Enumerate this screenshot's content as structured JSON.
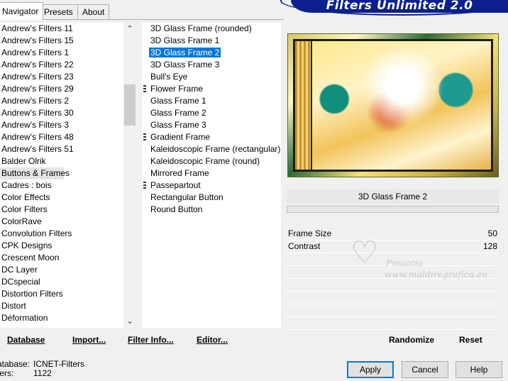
{
  "tabs": [
    {
      "label": "Navigator",
      "active": true
    },
    {
      "label": "Presets",
      "active": false
    },
    {
      "label": "About",
      "active": false
    }
  ],
  "banner_title": "Filters Unlimited 2.0",
  "categories": [
    "Andrew's Filters 11",
    "Andrew's Filters 15",
    "Andrew's Filters 1",
    "Andrew's Filters 22",
    "Andrew's Filters 23",
    "Andrew's Filters 29",
    "Andrew's Filters 2",
    "Andrew's Filters 30",
    "Andrew's Filters 3",
    "Andrew's Filters 48",
    "Andrew's Filters 51",
    "Balder Olrik",
    "Buttons & Frames",
    "Cadres : bois",
    "Color Effects",
    "Color Filters",
    "ColorRave",
    "Convolution Filters",
    "CPK Designs",
    "Crescent Moon",
    "DC Layer",
    "DCspecial",
    "Distortion Filters",
    "Distort",
    "Déformation"
  ],
  "selected_category": "Buttons & Frames",
  "filters": [
    {
      "label": "3D Glass Frame (rounded)",
      "sep": false,
      "selected": false
    },
    {
      "label": "3D Glass Frame 1",
      "sep": false,
      "selected": false
    },
    {
      "label": "3D Glass Frame 2",
      "sep": false,
      "selected": true
    },
    {
      "label": "3D Glass Frame 3",
      "sep": false,
      "selected": false
    },
    {
      "label": "Bull's Eye",
      "sep": false,
      "selected": false
    },
    {
      "label": "Flower Frame",
      "sep": true,
      "selected": false
    },
    {
      "label": "Glass Frame 1",
      "sep": false,
      "selected": false
    },
    {
      "label": "Glass Frame 2",
      "sep": false,
      "selected": false
    },
    {
      "label": "Glass Frame 3",
      "sep": false,
      "selected": false
    },
    {
      "label": "Gradient Frame",
      "sep": true,
      "selected": false
    },
    {
      "label": "Kaleidoscopic Frame (rectangular)",
      "sep": false,
      "selected": false
    },
    {
      "label": "Kaleidoscopic Frame (round)",
      "sep": false,
      "selected": false
    },
    {
      "label": "Mirrored Frame",
      "sep": false,
      "selected": false
    },
    {
      "label": "Passepartout",
      "sep": true,
      "selected": false
    },
    {
      "label": "Rectangular Button",
      "sep": false,
      "selected": false
    },
    {
      "label": "Round Button",
      "sep": false,
      "selected": false
    }
  ],
  "filter_name": "3D Glass Frame 2",
  "params": [
    {
      "label": "Frame Size",
      "value": "50"
    },
    {
      "label": "Contrast",
      "value": "128"
    }
  ],
  "watermark": {
    "name": "Pinuccia",
    "url": "www.maldiregrafica.eu"
  },
  "bottom": {
    "database": "Database",
    "import": "Import...",
    "filter_info": "Filter Info...",
    "editor": "Editor...",
    "randomize": "Randomize",
    "reset": "Reset"
  },
  "info": {
    "database_label": "atabase:",
    "database_value": "ICNET-Filters",
    "filters_label": "ters:",
    "filters_value": "1122"
  },
  "buttons": {
    "apply": "Apply",
    "cancel": "Cancel",
    "help": "Help"
  },
  "icons": {
    "scroll_up": "chevron-up-icon",
    "scroll_down": "chevron-down-icon",
    "watermark": "heart-icon"
  }
}
